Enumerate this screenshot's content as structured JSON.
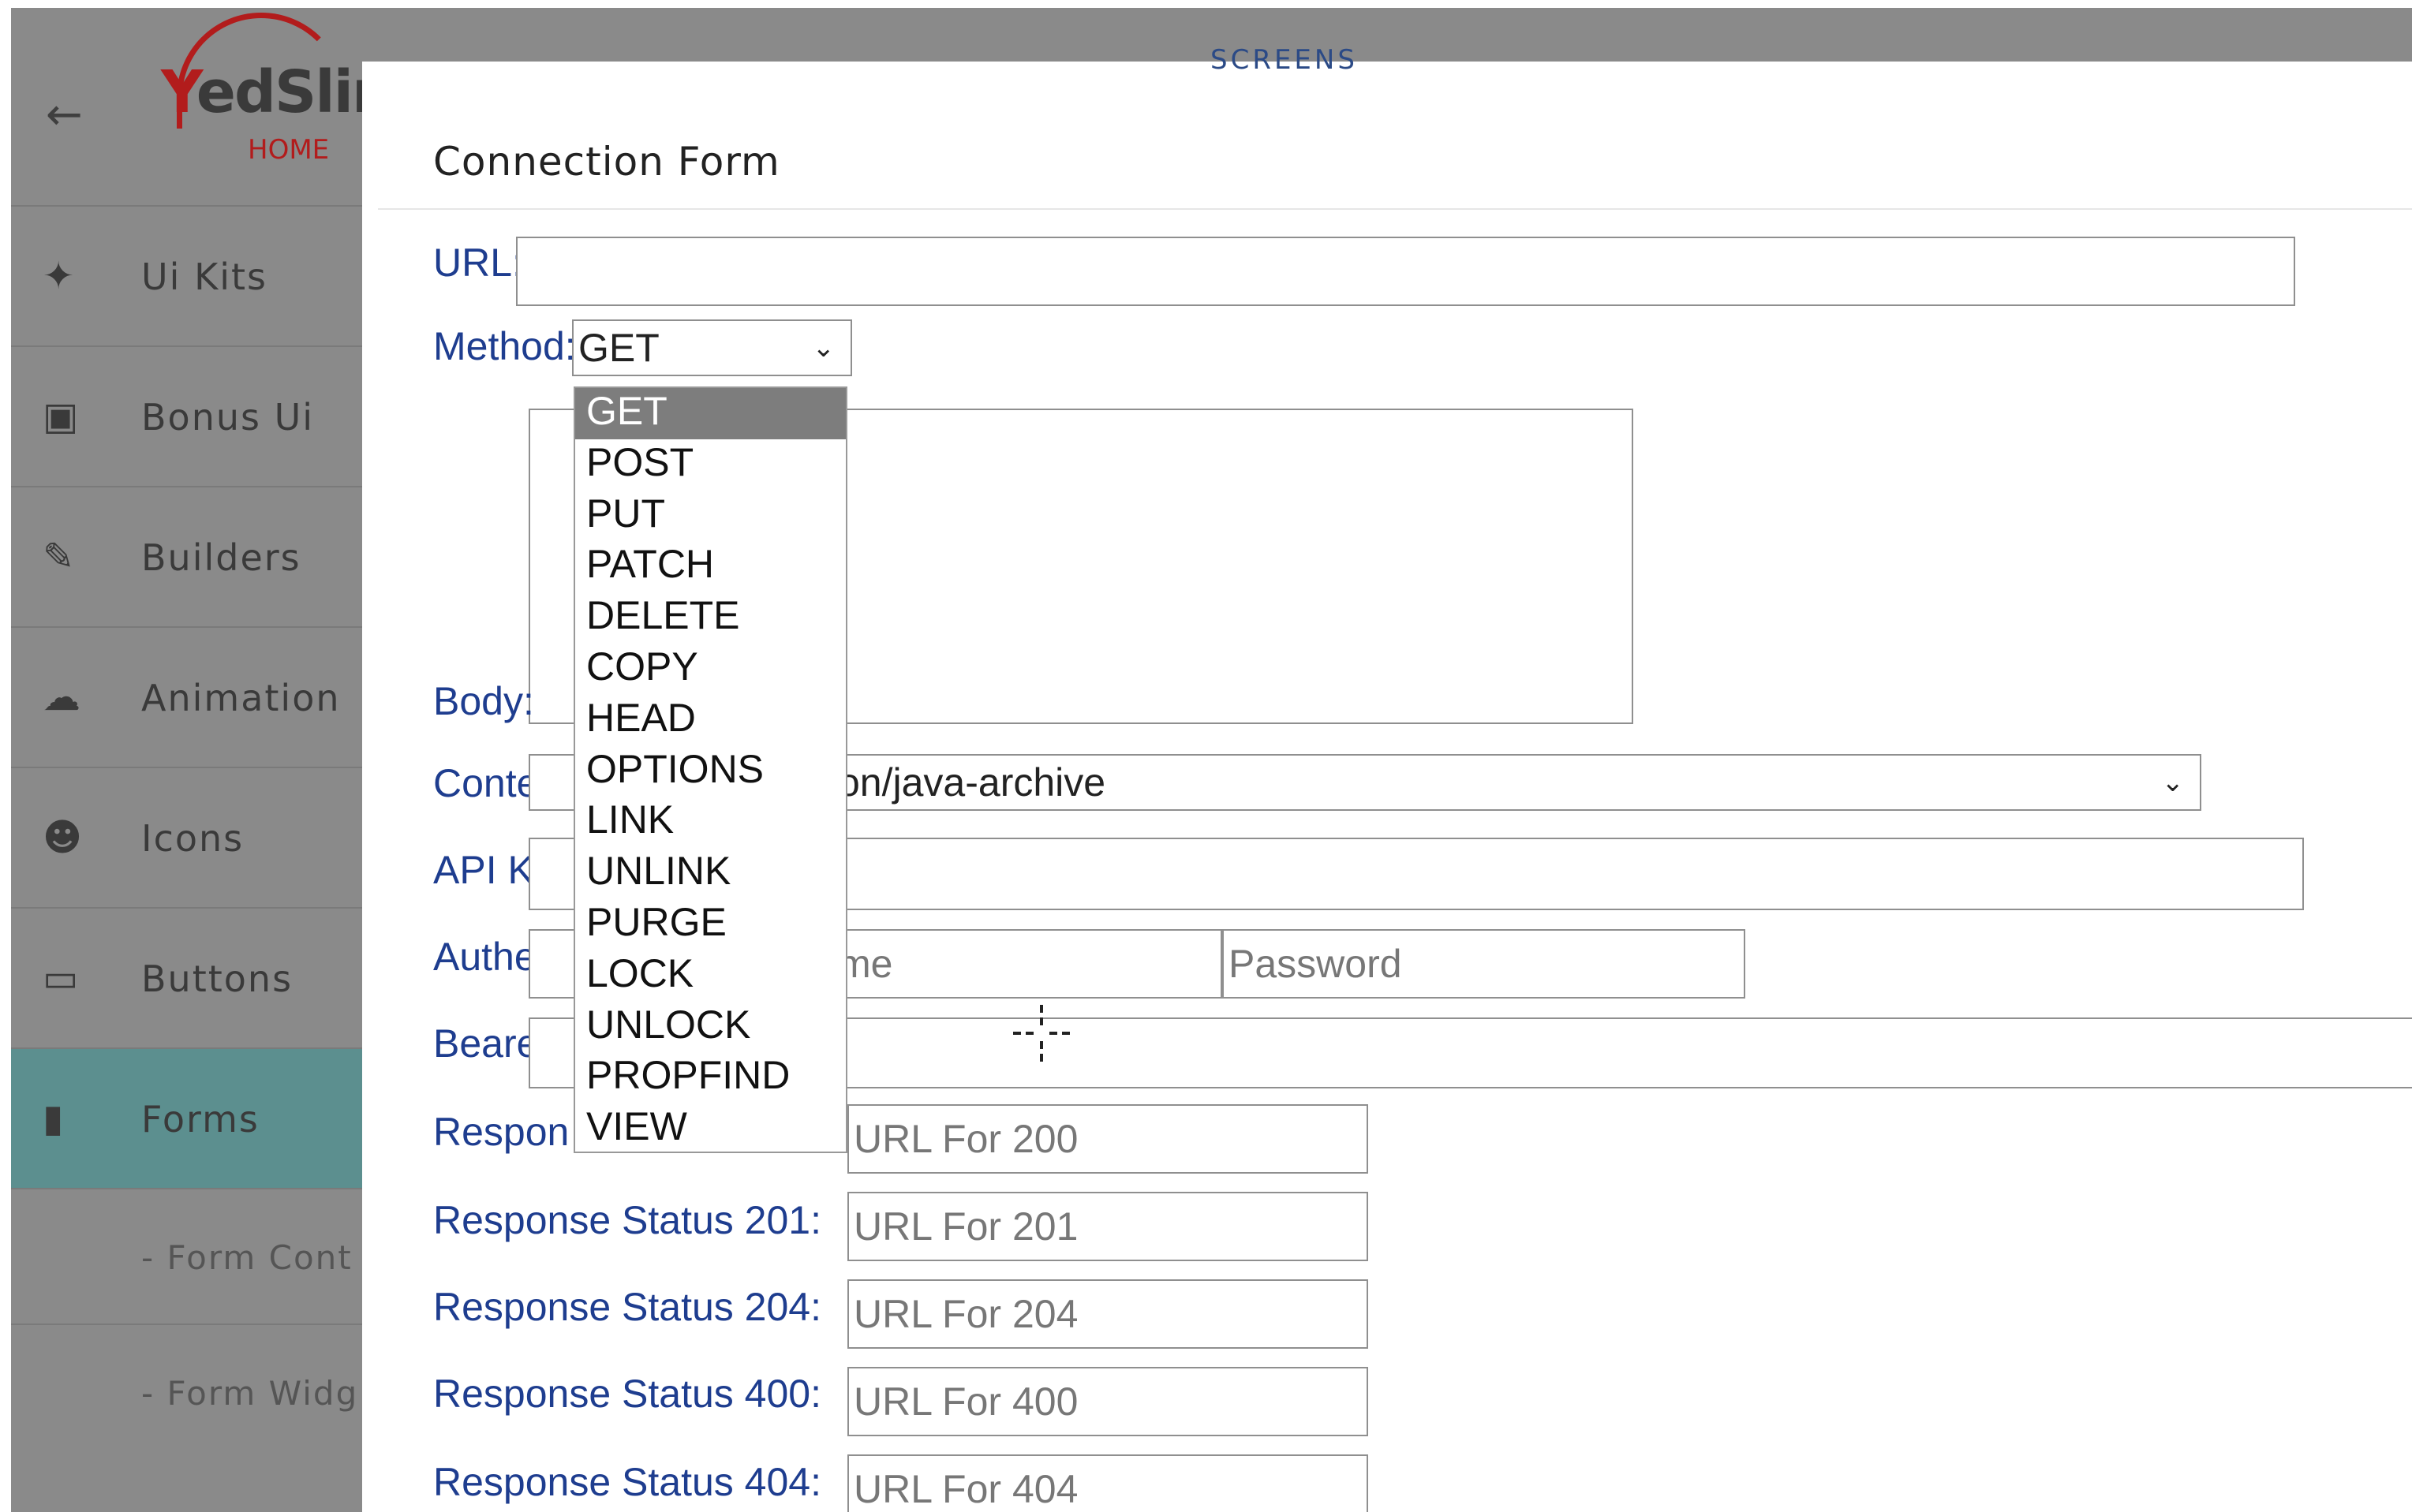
{
  "sidebar": {
    "back_icon": "arrow-left-icon",
    "logo": "YedSlim",
    "home": "HOME",
    "items": [
      {
        "label": "Ui Kits",
        "icon": "tools-icon"
      },
      {
        "label": "Bonus Ui",
        "icon": "gift-icon"
      },
      {
        "label": "Builders",
        "icon": "pencil-icon"
      },
      {
        "label": "Animation",
        "icon": "cloud-rain-icon"
      },
      {
        "label": "Icons",
        "icon": "smiley-icon"
      },
      {
        "label": "Buttons",
        "icon": "button-icon"
      },
      {
        "label": "Forms",
        "icon": "file-icon",
        "active": true
      },
      {
        "label": "- Form Cont",
        "sub": true
      },
      {
        "label": "- Form Widg",
        "sub": true
      }
    ]
  },
  "header": {
    "screens": "SCREENS"
  },
  "form": {
    "title": "Connection Form",
    "url_label": "URL:",
    "url_value": "",
    "method_label": "Method:",
    "method_value": "GET",
    "method_options": [
      "GET",
      "POST",
      "PUT",
      "PATCH",
      "DELETE",
      "COPY",
      "HEAD",
      "OPTIONS",
      "LINK",
      "UNLINK",
      "PURGE",
      "LOCK",
      "UNLOCK",
      "PROPFIND",
      "VIEW"
    ],
    "body_label": "Body:",
    "content_label": "Content",
    "content_value": "on/java-archive",
    "apikey_label": "API Key",
    "auth_label": "Authenti",
    "auth_username_placeholder": "me",
    "auth_password_placeholder": "Password",
    "bearer_label": "Bearer t",
    "response_label_partial": "Respon",
    "responses": [
      {
        "label": "Response Status 201:",
        "placeholder": "URL For 201"
      },
      {
        "label": "Response Status 204:",
        "placeholder": "URL For 204"
      },
      {
        "label": "Response Status 400:",
        "placeholder": "URL For 400"
      },
      {
        "label": "Response Status 404:",
        "placeholder": "URL For 404"
      }
    ],
    "response200_placeholder": "URL For 200"
  },
  "colors": {
    "sidebar_bg": "#8a8a8a",
    "active_bg": "#5c8f8f",
    "label_blue": "#1e3d8f",
    "brand_red": "#b21c1c"
  }
}
